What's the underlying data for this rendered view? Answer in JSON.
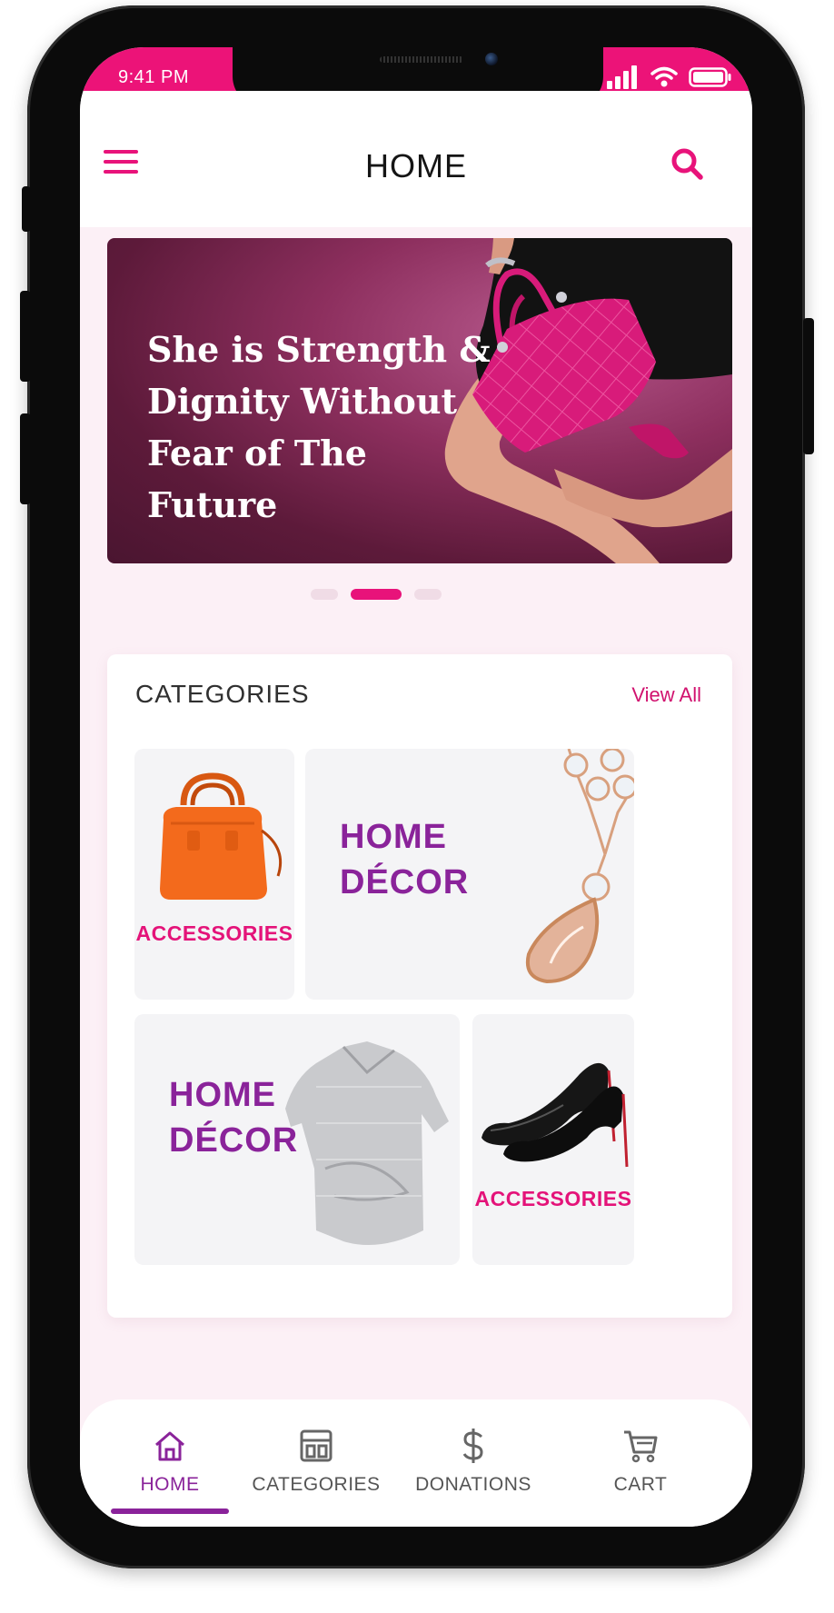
{
  "status_bar": {
    "time": "9:41 PM"
  },
  "header": {
    "title": "HOME"
  },
  "banner": {
    "headline": "She is Strength & Dignity  Without Fear of The Future"
  },
  "categories": {
    "title": "CATEGORIES",
    "view_all": "View All",
    "tiles": [
      {
        "label": "ACCESSORIES"
      },
      {
        "label": "HOME DÉCOR"
      },
      {
        "label": "HOME DÉCOR"
      },
      {
        "label": "ACCESSORIES"
      }
    ]
  },
  "bottom_nav": {
    "items": [
      {
        "label": "HOME",
        "icon": "home-icon",
        "active": true
      },
      {
        "label": "CATEGORIES",
        "icon": "categories-icon",
        "active": false
      },
      {
        "label": "DONATIONS",
        "icon": "dollar-icon",
        "active": false
      },
      {
        "label": "CART",
        "icon": "cart-icon",
        "active": false
      }
    ]
  },
  "colors": {
    "accent_pink": "#ec1378",
    "accent_purple": "#8a239a",
    "background": "#fcf0f6"
  }
}
